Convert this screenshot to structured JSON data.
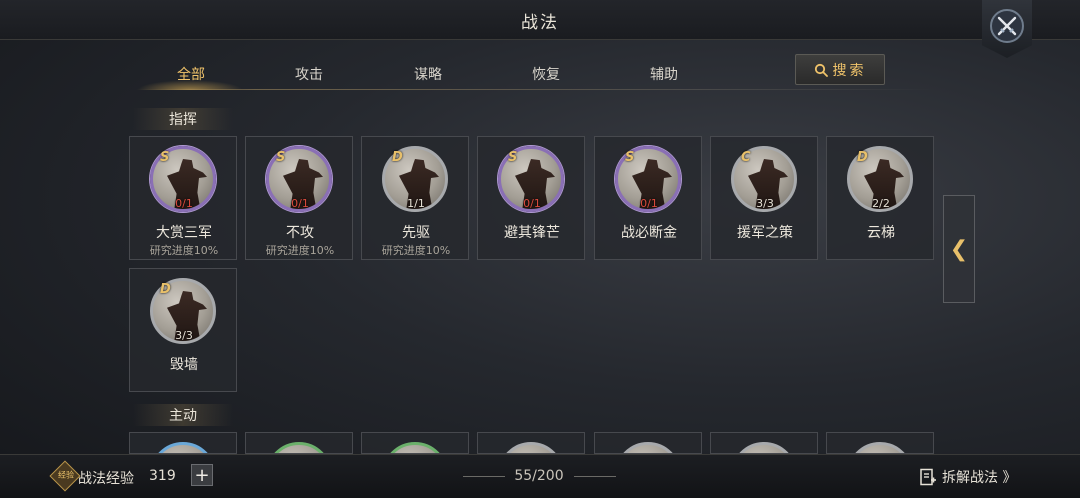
{
  "header": {
    "title": "战法"
  },
  "tabs": [
    {
      "label": "全部",
      "active": true
    },
    {
      "label": "攻击",
      "active": false
    },
    {
      "label": "谋略",
      "active": false
    },
    {
      "label": "恢复",
      "active": false
    },
    {
      "label": "辅助",
      "active": false
    }
  ],
  "search": {
    "label": "搜索",
    "icon": "search-icon"
  },
  "sections": [
    {
      "label": "指挥"
    },
    {
      "label": "主动"
    }
  ],
  "command_cards": [
    {
      "grade": "S",
      "count": "0/1",
      "count_color": "#d94a3c",
      "name": "大赏三军",
      "progress": "研究进度10%",
      "ring": "purple"
    },
    {
      "grade": "S",
      "count": "0/1",
      "count_color": "#d94a3c",
      "name": "不攻",
      "progress": "研究进度10%",
      "ring": "purple"
    },
    {
      "grade": "D",
      "count": "1/1",
      "count_color": "#e8e2d6",
      "name": "先驱",
      "progress": "研究进度10%",
      "ring": "gray"
    },
    {
      "grade": "S",
      "count": "0/1",
      "count_color": "#d94a3c",
      "name": "避其锋芒",
      "progress": "",
      "ring": "purple"
    },
    {
      "grade": "S",
      "count": "0/1",
      "count_color": "#d94a3c",
      "name": "战必断金",
      "progress": "",
      "ring": "purple"
    },
    {
      "grade": "C",
      "count": "3/3",
      "count_color": "#e8e2d6",
      "name": "援军之策",
      "progress": "",
      "ring": "gray"
    },
    {
      "grade": "D",
      "count": "2/2",
      "count_color": "#e8e2d6",
      "name": "云梯",
      "progress": "",
      "ring": "gray"
    },
    {
      "grade": "D",
      "count": "3/3",
      "count_color": "#e8e2d6",
      "name": "毁墙",
      "progress": "",
      "ring": "gray"
    }
  ],
  "active_cards_rings": [
    "blue",
    "green",
    "green",
    "gray",
    "gray",
    "gray",
    "gray"
  ],
  "side_arrow": {
    "icon": "chevron-left-icon",
    "glyph": "❮"
  },
  "footer": {
    "exp_icon_text": "经验",
    "exp_label": "战法经验",
    "exp_value": "319",
    "plus": "+",
    "page": "55/200",
    "dismantle_label": "拆解战法 》"
  },
  "colors": {
    "accent": "#f0c36a",
    "purple_ring": "#8a6fb5",
    "count_red": "#d94a3c"
  }
}
